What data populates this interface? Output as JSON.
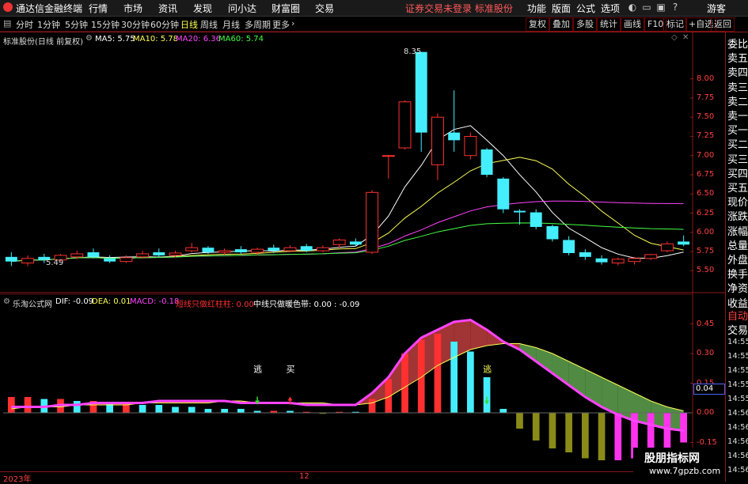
{
  "app": {
    "title": "通达信金融终端",
    "menu": [
      "行情",
      "市场",
      "资讯",
      "发现",
      "问小达",
      "财富圈",
      "交易"
    ],
    "notice": "证券交易未登录  标准股份",
    "right_menu": [
      "功能",
      "版面",
      "公式",
      "选项"
    ],
    "guest": "游客"
  },
  "toolbar": {
    "periods": [
      "分时",
      "1分钟",
      "5分钟",
      "15分钟",
      "30分钟",
      "60分钟",
      "日线",
      "周线",
      "月线",
      "多周期",
      "更多"
    ],
    "active_period": "日线",
    "buttons": [
      "复权",
      "叠加",
      "多股",
      "统计",
      "画线",
      "F10",
      "标记",
      "+自选",
      "返回"
    ]
  },
  "main_chart": {
    "stock_label": "标准股份(日线 前复权)",
    "ma": [
      {
        "label": "MA5: 5.75",
        "color": "#ffffff"
      },
      {
        "label": "MA10: 5.78",
        "color": "#ffff55"
      },
      {
        "label": "MA20: 6.36",
        "color": "#ff44ff"
      },
      {
        "label": "MA60: 5.74",
        "color": "#44ff44"
      }
    ],
    "ymin": 5.4,
    "ymax": 8.45,
    "yticks": [
      "8.00",
      "7.75",
      "7.50",
      "7.25",
      "7.00",
      "6.75",
      "6.50",
      "6.25",
      "6.00",
      "5.75",
      "5.50"
    ],
    "high_label": "8.35",
    "low_label": "5.49",
    "candles": [
      [
        5.68,
        5.62,
        5.74,
        5.56
      ],
      [
        5.6,
        5.66,
        5.7,
        5.56
      ],
      [
        5.68,
        5.64,
        5.72,
        5.6
      ],
      [
        5.64,
        5.7,
        5.72,
        5.62
      ],
      [
        5.68,
        5.72,
        5.76,
        5.65
      ],
      [
        5.74,
        5.68,
        5.79,
        5.66
      ],
      [
        5.66,
        5.62,
        5.7,
        5.6
      ],
      [
        5.62,
        5.67,
        5.7,
        5.6
      ],
      [
        5.68,
        5.72,
        5.76,
        5.66
      ],
      [
        5.74,
        5.7,
        5.79,
        5.68
      ],
      [
        5.7,
        5.73,
        5.76,
        5.67
      ],
      [
        5.76,
        5.8,
        5.86,
        5.74
      ],
      [
        5.8,
        5.74,
        5.82,
        5.72
      ],
      [
        5.74,
        5.76,
        5.79,
        5.71
      ],
      [
        5.78,
        5.74,
        5.82,
        5.72
      ],
      [
        5.74,
        5.78,
        5.8,
        5.7
      ],
      [
        5.8,
        5.76,
        5.84,
        5.73
      ],
      [
        5.76,
        5.8,
        5.83,
        5.74
      ],
      [
        5.82,
        5.76,
        5.85,
        5.74
      ],
      [
        5.76,
        5.8,
        5.83,
        5.74
      ],
      [
        5.84,
        5.9,
        5.92,
        5.8
      ],
      [
        5.88,
        5.84,
        5.92,
        5.82
      ],
      [
        5.74,
        6.52,
        6.55,
        5.72
      ],
      [
        7.0,
        7.0,
        7.01,
        6.7
      ],
      [
        7.1,
        7.7,
        7.72,
        7.08
      ],
      [
        8.35,
        7.3,
        8.35,
        7.05
      ],
      [
        6.88,
        7.5,
        7.55,
        6.68
      ],
      [
        7.3,
        7.2,
        7.85,
        7.05
      ],
      [
        7.0,
        7.25,
        7.3,
        6.95
      ],
      [
        7.08,
        6.75,
        7.1,
        6.72
      ],
      [
        6.7,
        6.3,
        6.72,
        6.25
      ],
      [
        6.28,
        6.26,
        6.3,
        6.1
      ],
      [
        6.26,
        6.07,
        6.3,
        6.04
      ],
      [
        6.08,
        5.91,
        6.1,
        5.88
      ],
      [
        5.9,
        5.73,
        5.95,
        5.7
      ],
      [
        5.74,
        5.68,
        5.78,
        5.64
      ],
      [
        5.66,
        5.61,
        5.7,
        5.58
      ],
      [
        5.6,
        5.65,
        5.67,
        5.57
      ],
      [
        5.62,
        5.66,
        5.68,
        5.58
      ],
      [
        5.66,
        5.71,
        5.72,
        5.64
      ],
      [
        5.76,
        5.85,
        5.88,
        5.74
      ],
      [
        5.88,
        5.84,
        5.96,
        5.82
      ]
    ]
  },
  "macd_panel": {
    "title": "乐淘公式网",
    "items": [
      {
        "label": "DIF: -0.09",
        "color": "#ffffff"
      },
      {
        "label": "DEA: 0.01",
        "color": "#ffff55"
      },
      {
        "label": "MACD: -0.18",
        "color": "#ff44ff"
      },
      {
        "label": "短线只做红柱柱: 0.00",
        "color": "#ff3030"
      },
      {
        "label": "中线只做暖色带: 0.00  : -0.09",
        "color": "#ffffff"
      }
    ],
    "ymin": -0.28,
    "ymax": 0.52,
    "yticks": [
      "0.45",
      "0.30",
      "0.15",
      "0.00",
      "-0.15"
    ],
    "bars": [
      0.08,
      0.08,
      0.07,
      0.07,
      0.06,
      0.06,
      0.05,
      0.05,
      0.04,
      0.04,
      0.03,
      0.03,
      0.02,
      0.02,
      0.02,
      0.01,
      0.01,
      0.01,
      0.005,
      -0.005,
      0.005,
      0.005,
      0.07,
      0.17,
      0.3,
      0.37,
      0.4,
      0.36,
      0.31,
      0.18,
      0.02,
      -0.08,
      -0.14,
      -0.18,
      -0.2,
      -0.23,
      -0.24,
      -0.24,
      -0.23,
      -0.22,
      -0.18,
      -0.15
    ],
    "dif": [
      0.03,
      0.03,
      0.03,
      0.04,
      0.04,
      0.05,
      0.05,
      0.05,
      0.05,
      0.06,
      0.06,
      0.06,
      0.06,
      0.06,
      0.05,
      0.05,
      0.05,
      0.05,
      0.04,
      0.04,
      0.04,
      0.04,
      0.1,
      0.18,
      0.3,
      0.38,
      0.42,
      0.46,
      0.47,
      0.42,
      0.36,
      0.32,
      0.26,
      0.2,
      0.14,
      0.08,
      0.03,
      -0.01,
      -0.04,
      -0.06,
      -0.08,
      -0.09
    ],
    "dea": [
      0.02,
      0.03,
      0.03,
      0.03,
      0.04,
      0.04,
      0.04,
      0.04,
      0.05,
      0.05,
      0.05,
      0.05,
      0.05,
      0.06,
      0.06,
      0.05,
      0.05,
      0.05,
      0.05,
      0.05,
      0.04,
      0.04,
      0.05,
      0.08,
      0.13,
      0.18,
      0.24,
      0.28,
      0.32,
      0.34,
      0.35,
      0.35,
      0.33,
      0.3,
      0.26,
      0.22,
      0.18,
      0.14,
      0.1,
      0.06,
      0.03,
      0.01
    ],
    "signals": [
      {
        "label": "逃",
        "index": 15,
        "color": "#ffffff",
        "arrow": "down"
      },
      {
        "label": "买",
        "index": 17,
        "color": "#ffffff",
        "arrow": "up"
      },
      {
        "label": "逃",
        "index": 29,
        "color": "#ffff55",
        "arrow": "down"
      }
    ],
    "current_value": "0.04"
  },
  "time_axis": {
    "labels": [
      "2023年",
      "12"
    ]
  },
  "right_panel": {
    "items": [
      "委比",
      "卖五",
      "卖四",
      "卖三",
      "卖二",
      "卖一",
      "买一",
      "买二",
      "买三",
      "买四",
      "买五",
      "现价",
      "涨跌",
      "涨幅",
      "总量",
      "外盘",
      "换手",
      "净资",
      "收益"
    ],
    "tabs": [
      "自动",
      "交易"
    ],
    "times": [
      "14:55",
      "14:55",
      "14:55",
      "14:55",
      "14:55",
      "14:56",
      "14:56",
      "14:56",
      "14:56",
      "14:56"
    ]
  },
  "watermark": {
    "line1": "股朋指标网",
    "line2": "www.7gpzb.com"
  },
  "colors": {
    "up": "#ff3030",
    "down": "#44eeff",
    "grid": "#8a1a1a",
    "bg": "#000000"
  }
}
